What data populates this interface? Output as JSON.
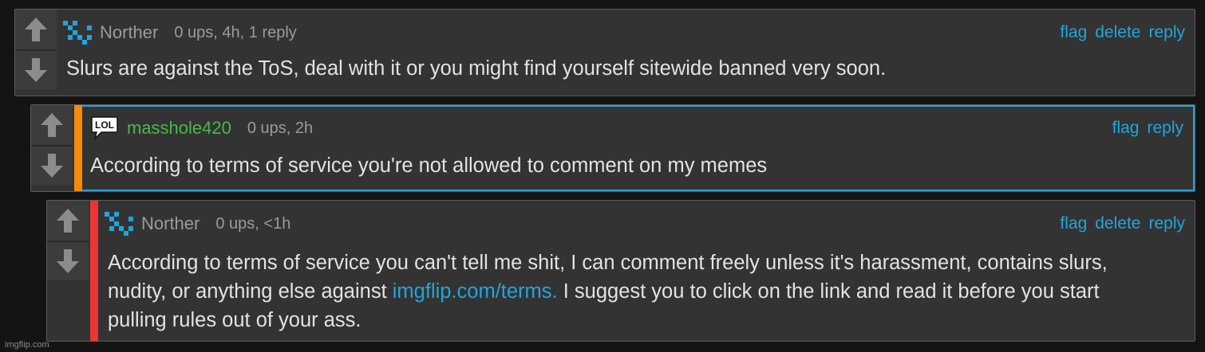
{
  "comments": [
    {
      "username": "Norther",
      "meta": "0 ups, 4h, 1 reply",
      "actions": [
        "flag",
        "delete",
        "reply"
      ],
      "text": "Slurs are against the ToS, deal with it or you might find yourself sitewide banned very soon.",
      "avatar": "pixel-avatar-icon"
    },
    {
      "username": "masshole420",
      "meta": "0 ups, 2h",
      "actions": [
        "flag",
        "reply"
      ],
      "text": "According to terms of service you're not allowed to comment on my memes",
      "avatar": "lol-speech-bubble-icon",
      "badge": "LOL",
      "stripe_color": "#f58a0b",
      "highlight_color": "#22a4dd"
    },
    {
      "username": "Norther",
      "meta": "0 ups, <1h",
      "actions": [
        "flag",
        "delete",
        "reply"
      ],
      "text_before_link": "According to terms of service you can't tell me shit, I can comment freely unless it's harassment, contains slurs, nudity, or anything else against ",
      "link_text": "imgflip.com/terms.",
      "text_after_link": " I suggest you to click on the link and read it before you start pulling rules out of your ass.",
      "avatar": "pixel-avatar-icon",
      "stripe_color": "#ef3434"
    }
  ],
  "watermark": "imgflip.com",
  "colors": {
    "background": "#141414",
    "panel": "#333333",
    "link": "#22a4dd",
    "mod_username": "#4ab848",
    "text": "#e2e2e2",
    "meta": "#9b9b9b"
  }
}
